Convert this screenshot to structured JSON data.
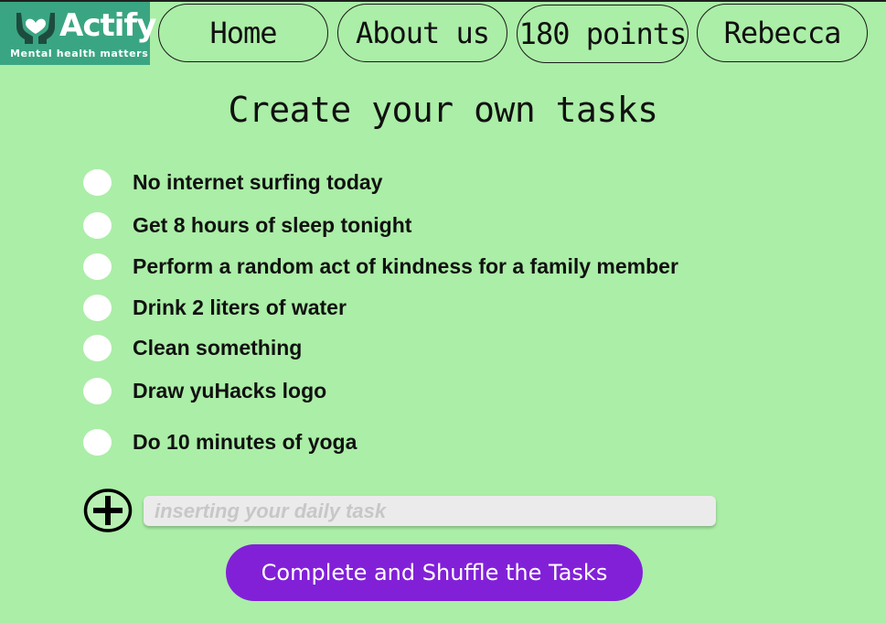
{
  "brand": {
    "name": "Actify",
    "tagline": "Mental health matters",
    "color": "#3aa582"
  },
  "nav": {
    "home": "Home",
    "about": "About us",
    "points": "180 points",
    "user": "Rebecca"
  },
  "page": {
    "title": "Create your own tasks"
  },
  "tasks": [
    {
      "label": "No internet surfing today"
    },
    {
      "label": "Get 8 hours of sleep tonight"
    },
    {
      "label": "Perform a random act of kindness for a family member"
    },
    {
      "label": "Drink 2 liters of water"
    },
    {
      "label": "Clean something"
    },
    {
      "label": "Draw yuHacks logo"
    },
    {
      "label": "Do 10 minutes of yoga"
    }
  ],
  "new_task": {
    "placeholder": "inserting your daily task",
    "value": ""
  },
  "actions": {
    "complete_label": "Complete and Shuffle the Tasks"
  },
  "colors": {
    "background": "#abeea7",
    "accent": "#8220d8",
    "input_bg": "#ebebeb"
  },
  "icons": {
    "logo": "hands-heart-icon",
    "add": "plus-circle-icon"
  }
}
